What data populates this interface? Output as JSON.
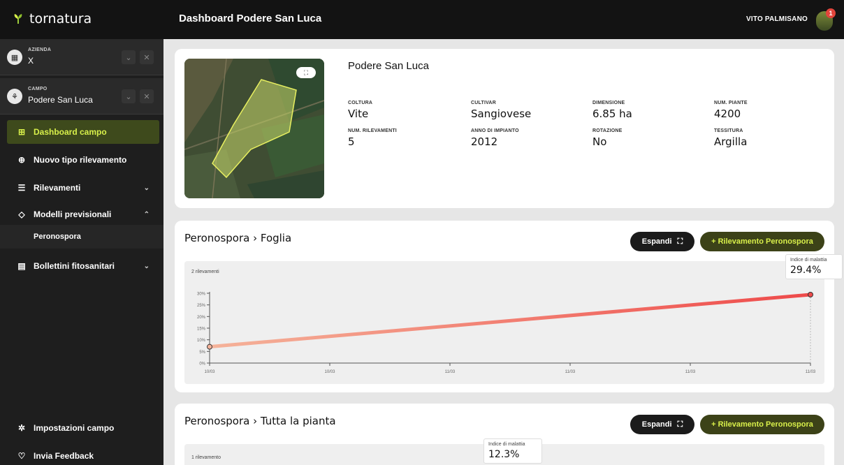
{
  "app": {
    "brand": "tornatura",
    "page_title": "Dashboard Podere San Luca",
    "user": "VITO PALMISANO",
    "notifications": "1"
  },
  "sidebar": {
    "azienda": {
      "label": "AZIENDA",
      "value": "X"
    },
    "campo": {
      "label": "CAMPO",
      "value": "Podere San Luca"
    },
    "items": [
      {
        "label": "Dashboard campo"
      },
      {
        "label": "Nuovo tipo rilevamento"
      },
      {
        "label": "Rilevamenti"
      },
      {
        "label": "Modelli previsionali"
      },
      {
        "label": "Bollettini fitosanitari"
      }
    ],
    "sub_item": "Peronospora",
    "bottom": [
      {
        "label": "Impostazioni campo"
      },
      {
        "label": "Invia Feedback"
      }
    ]
  },
  "field_card": {
    "name": "Podere San Luca",
    "info": [
      {
        "label": "COLTURA",
        "value": "Vite"
      },
      {
        "label": "CULTIVAR",
        "value": "Sangiovese"
      },
      {
        "label": "DIMENSIONE",
        "value": "6.85 ha"
      },
      {
        "label": "NUM. PIANTE",
        "value": "4200"
      },
      {
        "label": "NUM. RILEVAMENTI",
        "value": "5"
      },
      {
        "label": "ANNO DI IMPIANTO",
        "value": "2012"
      },
      {
        "label": "ROTAZIONE",
        "value": "No"
      },
      {
        "label": "TESSITURA",
        "value": "Argilla"
      }
    ]
  },
  "section1": {
    "title": "Peronospora  ›  Foglia",
    "expand_label": "Espandi",
    "add_label": "+ Rilevamento Peronospora",
    "count_label": "2 rilevamenti",
    "tooltip_label": "Indice di malattia",
    "tooltip_value": "29.4%"
  },
  "section2": {
    "title": "Peronospora  ›  Tutta la pianta",
    "expand_label": "Espandi",
    "add_label": "+ Rilevamento Peronospora",
    "count_label": "1 rilevamento",
    "tooltip_label": "Indice di malattia",
    "tooltip_value": "12.3%"
  },
  "chart_data": {
    "type": "line",
    "title": "",
    "x": [
      "10/03",
      "11/03"
    ],
    "series": [
      {
        "values": [
          7,
          29.4
        ]
      }
    ],
    "tick_labels_x": [
      "10/03",
      "10/03",
      "11/03",
      "11/03",
      "11/03",
      "11/03"
    ],
    "tick_labels_y": [
      "0%",
      "5%",
      "10%",
      "15%",
      "20%",
      "25%",
      "30%"
    ],
    "ylim": [
      0,
      30
    ],
    "grid": false,
    "color_start": "#f5b39a",
    "color_end": "#ee4a4a"
  }
}
